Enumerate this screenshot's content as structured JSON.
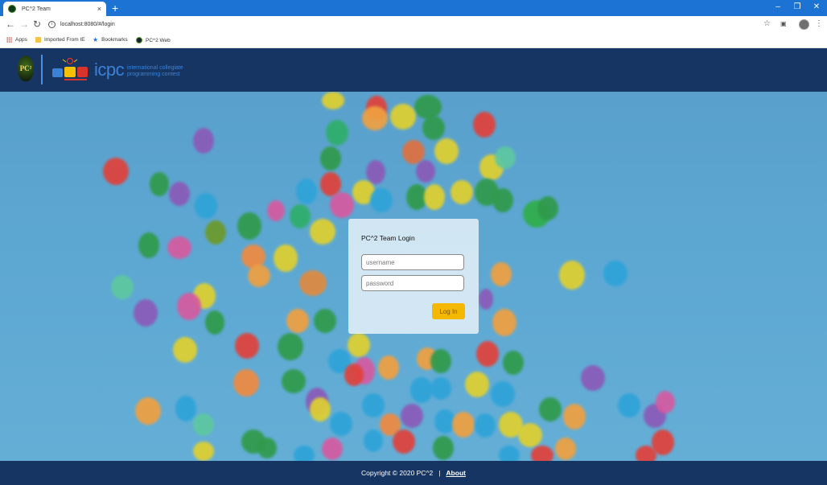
{
  "browser": {
    "tab_title": "PC^2 Team",
    "tab_close": "×",
    "new_tab": "+",
    "url": "localhost:8080/#/login",
    "window_controls": [
      "–",
      "❐",
      "✕"
    ],
    "bookmarks": [
      {
        "label": "Apps",
        "icon": "apps-grid-icon"
      },
      {
        "label": "Imported From IE",
        "icon": "folder-icon"
      },
      {
        "label": "Bookmarks",
        "icon": "star-icon"
      },
      {
        "label": "PC^2 Web",
        "icon": "pc2-favicon-icon"
      }
    ]
  },
  "header": {
    "logo_text": "PC²",
    "icpc_text": "icpc",
    "icpc_subtitle_line1": "international collegiate",
    "icpc_subtitle_line2": "programming contest"
  },
  "login": {
    "title": "PC^2 Team Login",
    "username_placeholder": "username",
    "password_placeholder": "password",
    "button_label": "Log In"
  },
  "footer": {
    "copyright": "Copyright © 2020 PC^2",
    "separator": "|",
    "about_label": "About"
  },
  "colors": {
    "header_bg": "#163562",
    "accent": "#3b82d6",
    "button": "#f5b800",
    "tabbar": "#1c73d3"
  }
}
